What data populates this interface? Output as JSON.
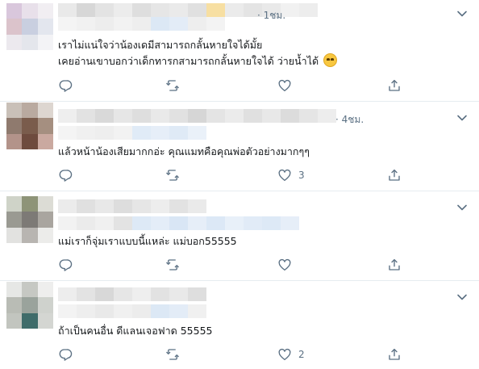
{
  "colors": {
    "muted": "#5b7083",
    "text": "#14171a",
    "divider": "#e6ecf0"
  },
  "replies": [
    {
      "time": "· 1ชม.",
      "lines": [
        "เราไม่แน่ใจว่าน้องเดมีสามารถกลั้นหายใจได้มั้ย",
        "เคยอ่านเขาบอกว่าเด็กทารกสามารถกลั้นหายใจได้ ว่ายน้ำได้"
      ],
      "emoji": "face-with-rolling-eyes-emoji",
      "like_count": ""
    },
    {
      "time": "· 4ชม.",
      "lines": [
        "แล้วหน้าน้องเสียมากกอ่ะ คุณแมทคือคุณพ่อตัวอย่างมากๆๆ"
      ],
      "like_count": "3"
    },
    {
      "time": "",
      "lines": [
        "แม่เราก็จุ่มเราแบบนี้แหล่ะ แม่บอก55555"
      ],
      "like_count": ""
    },
    {
      "time": "",
      "lines": [
        "ถ้าเป็นคนอื่น ดีแลนเจอฟาด 55555"
      ],
      "like_count": "2"
    }
  ],
  "icons": {
    "reply": "reply-icon",
    "retweet": "retweet-icon",
    "like": "like-icon",
    "share": "share-icon",
    "more": "chevron-down-icon"
  }
}
